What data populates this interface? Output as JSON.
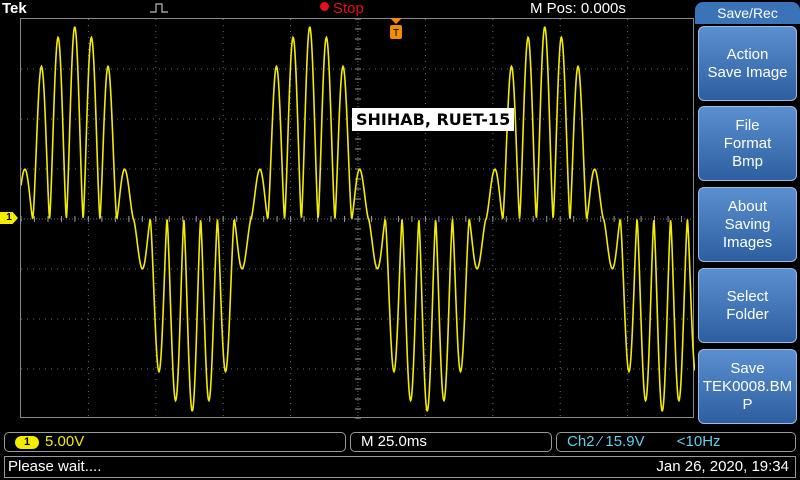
{
  "header": {
    "brand": "Tek",
    "run_status": "Stop",
    "position_readout": "M Pos: 0.000s"
  },
  "display": {
    "channel_marker": "1",
    "annotation": "SHIHAB, RUET-15",
    "trace_color": "#f2ec00"
  },
  "menu": {
    "title": "Save/Rec",
    "buttons": [
      {
        "line1": "Action",
        "line2": "Save Image",
        "line3": ""
      },
      {
        "line1": "File",
        "line2": "Format",
        "line3": "Bmp"
      },
      {
        "line1": "About",
        "line2": "Saving",
        "line3": "Images"
      },
      {
        "line1": "Select",
        "line2": "Folder",
        "line3": ""
      },
      {
        "line1": "Save",
        "line2": "TEK0008.BM",
        "line3": "P"
      }
    ]
  },
  "status": {
    "ch1_badge": "1",
    "ch1_scale": "5.00V",
    "timebase": "M 25.0ms",
    "trigger_source": "Ch2",
    "trigger_slope": "⁄",
    "trigger_level": "15.9V",
    "frequency": "<10Hz"
  },
  "message": {
    "text": "Please wait....",
    "datetime": "Jan 26, 2020, 19:34"
  }
}
